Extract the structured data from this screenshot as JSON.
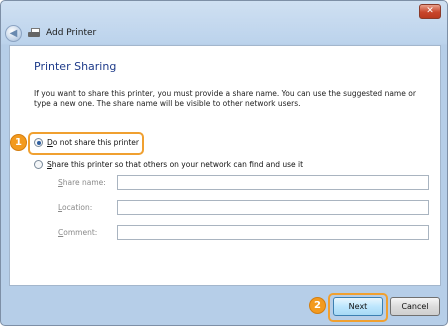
{
  "window": {
    "close_glyph": "✕",
    "back_glyph": "◀",
    "header_title": "Add Printer"
  },
  "page": {
    "title": "Printer Sharing",
    "description": "If you want to share this printer, you must provide a share name. You can use the suggested name or type a new one. The share name will be visible to other network users."
  },
  "options": {
    "no_share": {
      "mnemonic": "D",
      "rest": "o not share this printer",
      "selected": true
    },
    "share": {
      "mnemonic": "S",
      "rest": "hare this printer so that others on your network can find and use it",
      "selected": false
    }
  },
  "fields": [
    {
      "mnemonic": "S",
      "rest": "hare name:",
      "value": ""
    },
    {
      "mnemonic": "L",
      "rest": "ocation:",
      "value": ""
    },
    {
      "mnemonic": "C",
      "rest": "omment:",
      "value": ""
    }
  ],
  "buttons": {
    "next": "Next",
    "cancel": "Cancel"
  },
  "callouts": {
    "one": "1",
    "two": "2"
  },
  "colors": {
    "accent_orange": "#f39a1e",
    "title_blue": "#1e3b8a"
  }
}
